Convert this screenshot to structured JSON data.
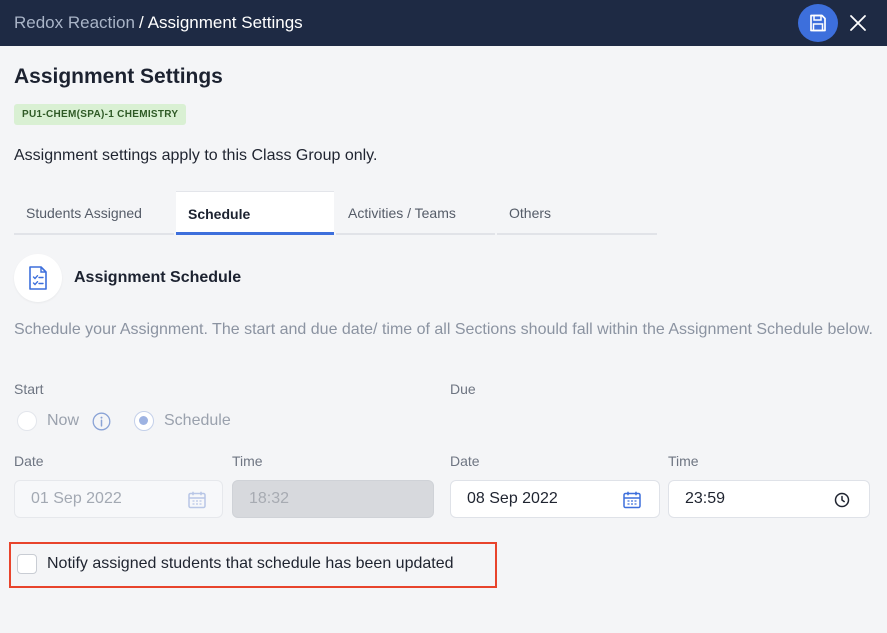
{
  "header": {
    "breadcrumb_parent": "Redox Reaction",
    "breadcrumb_separator": "/",
    "breadcrumb_current": "Assignment Settings",
    "save_icon": "floppy-disk-icon",
    "close_icon": "close-icon"
  },
  "page": {
    "title": "Assignment Settings",
    "class_badge": "PU1-CHEM(SPA)-1 CHEMISTRY",
    "scope_note": "Assignment settings apply to this Class Group only."
  },
  "tabs": [
    {
      "label": "Students Assigned",
      "active": false
    },
    {
      "label": "Schedule",
      "active": true
    },
    {
      "label": "Activities / Teams",
      "active": false
    },
    {
      "label": "Others",
      "active": false
    }
  ],
  "schedule": {
    "icon": "checklist-document-icon",
    "title": "Assignment Schedule",
    "description": "Schedule your Assignment. The start and due date/ time of all Sections should fall within the Assignment Schedule below.",
    "start": {
      "label": "Start",
      "option_now": "Now",
      "option_schedule": "Schedule",
      "selected": "Schedule",
      "date_label": "Date",
      "date_value": "01 Sep 2022",
      "time_label": "Time",
      "time_value": "18:32"
    },
    "due": {
      "label": "Due",
      "date_label": "Date",
      "date_value": "08 Sep 2022",
      "time_label": "Time",
      "time_value": "23:59"
    },
    "notify_label": "Notify assigned students that schedule has been updated",
    "notify_checked": false
  },
  "colors": {
    "header_bg": "#1e2a44",
    "accent": "#3d6fdc",
    "badge_bg": "#d9f0d3",
    "highlight_border": "#e8442c"
  }
}
